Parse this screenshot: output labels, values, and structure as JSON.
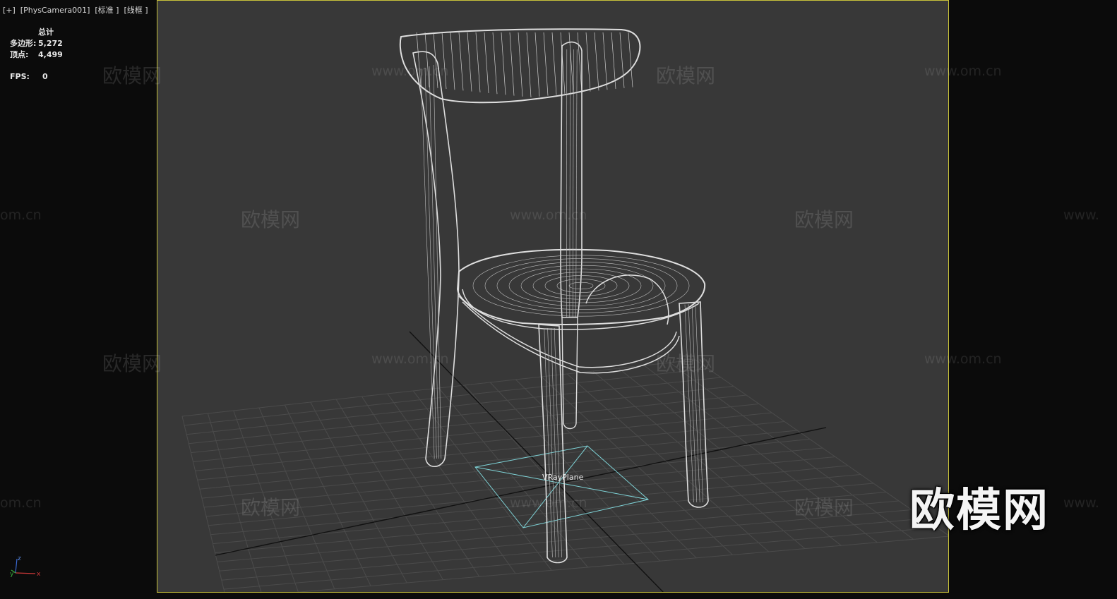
{
  "viewport": {
    "label": "[+]  [PhysCamera001]  [标准 ]  [线框 ]"
  },
  "stats": {
    "header": "总计",
    "polygons_label": "多边形:",
    "polygons_value": "5,272",
    "vertices_label": "顶点:",
    "vertices_value": "4,499",
    "fps_label": "FPS:",
    "fps_value": "0"
  },
  "scene": {
    "object_label": "VRayPlane"
  },
  "watermarks": {
    "brand": "欧模网",
    "url": "www.om.cn",
    "url_fragment_left": "om.cn",
    "url_fragment_right": "www.",
    "logo": "欧模网"
  },
  "axis": {
    "x": "x",
    "y": "y",
    "z": "z"
  },
  "colors": {
    "safe_frame": "#c8c23a",
    "viewport_bg": "#383838",
    "panel_bg": "#0b0b0b",
    "wireframe": "#e0e0e0",
    "grid": "#4a4a4a",
    "vray_plane": "#7fd4d8"
  }
}
